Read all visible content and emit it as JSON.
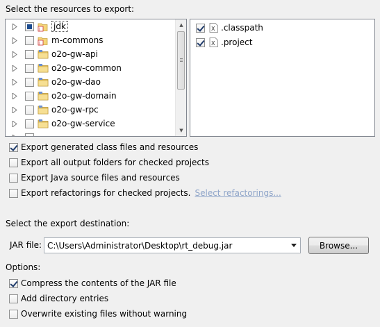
{
  "resources_label": "Select the resources to export:",
  "tree": [
    {
      "label": "jdk",
      "check": "partial",
      "icon": "library-project-icon"
    },
    {
      "label": "m-commons",
      "check": "none",
      "icon": "library-project-icon"
    },
    {
      "label": "o2o-gw-api",
      "check": "none",
      "icon": "folder-project-icon"
    },
    {
      "label": "o2o-gw-common",
      "check": "none",
      "icon": "folder-project-icon"
    },
    {
      "label": "o2o-gw-dao",
      "check": "none",
      "icon": "folder-project-icon"
    },
    {
      "label": "o2o-gw-domain",
      "check": "none",
      "icon": "folder-project-icon"
    },
    {
      "label": "o2o-gw-rpc",
      "check": "none",
      "icon": "folder-project-icon"
    },
    {
      "label": "o2o-gw-service",
      "check": "none",
      "icon": "folder-project-icon"
    }
  ],
  "files": [
    {
      "label": ".classpath",
      "check": "checked",
      "icon": "xml-file-icon"
    },
    {
      "label": ".project",
      "check": "checked",
      "icon": "xml-file-icon"
    }
  ],
  "export_options": {
    "generated": "Export generated class files and resources",
    "output_folders": "Export all output folders for checked projects",
    "java_source": "Export Java source files and resources",
    "refactorings": "Export refactorings for checked projects.",
    "select_refactorings": "Select refactorings..."
  },
  "destination_label": "Select the export destination:",
  "jar_file_label": "JAR file:",
  "jar_file_value": "C:\\Users\\Administrator\\Desktop\\rt_debug.jar",
  "browse_label": "Browse...",
  "options_label": "Options:",
  "options": {
    "compress": "Compress the contents of the JAR file",
    "directory": "Add directory entries",
    "overwrite": "Overwrite existing files without warning"
  },
  "checked_state": {
    "generated": true,
    "output_folders": false,
    "java_source": false,
    "refactorings": false,
    "compress": true,
    "directory": false,
    "overwrite": false
  }
}
